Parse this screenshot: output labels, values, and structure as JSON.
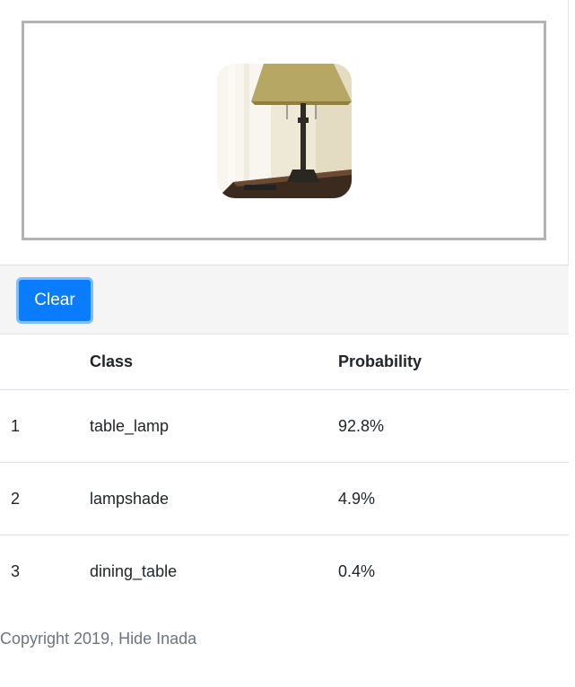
{
  "toolbar": {
    "clear_label": "Clear"
  },
  "results": {
    "headers": {
      "rank": "",
      "class": "Class",
      "probability": "Probability"
    },
    "rows": [
      {
        "rank": "1",
        "class": "table_lamp",
        "probability": "92.8%"
      },
      {
        "rank": "2",
        "class": "lampshade",
        "probability": "4.9%"
      },
      {
        "rank": "3",
        "class": "dining_table",
        "probability": "0.4%"
      }
    ]
  },
  "footer": {
    "text": "Copyright 2019, Hide Inada"
  },
  "colors": {
    "accent": "#0a7cff",
    "accent_focus_ring": "#80bdff",
    "toolbar_bg": "#f5f5f5",
    "drop_border": "#b3b3b3",
    "muted_text": "#6c757d"
  },
  "preview": {
    "subject": "table-lamp-photo"
  }
}
